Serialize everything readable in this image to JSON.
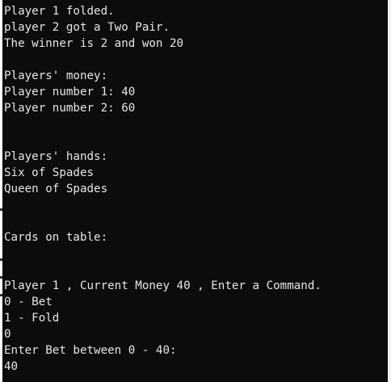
{
  "console": {
    "lines": [
      "Player 1 folded.",
      "player 2 got a Two Pair.",
      "The winner is 2 and won 20",
      "",
      "Players' money:",
      "Player number 1: 40",
      "Player number 2: 60",
      "",
      "",
      "Players' hands:",
      "Six of Spades",
      "Queen of Spades",
      "",
      "",
      "Cards on table:",
      "",
      "",
      "Player 1 , Current Money 40 , Enter a Command.",
      "0 - Bet",
      "1 - Fold",
      "0",
      "Enter Bet between 0 - 40:",
      "40"
    ]
  }
}
